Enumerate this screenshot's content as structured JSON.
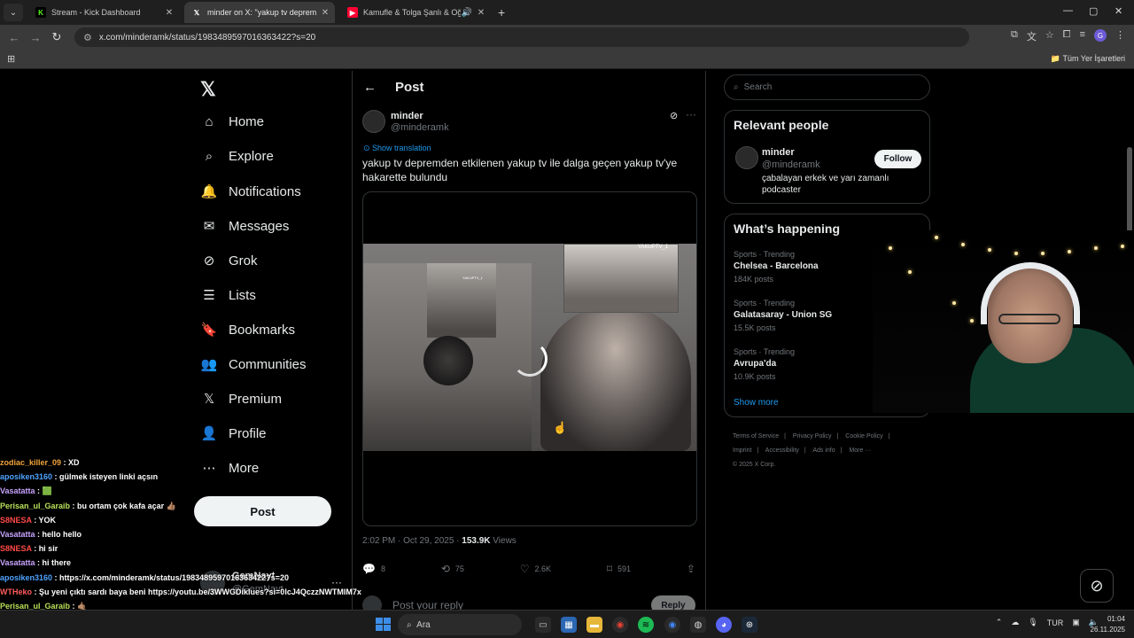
{
  "browser": {
    "tabs": [
      {
        "title": "Stream - Kick Dashboard",
        "favicon": "K",
        "color": "#53fc18",
        "active": false
      },
      {
        "title": "minder on X: \"yakup tv deprem",
        "favicon": "𝕏",
        "color": "#ffffff",
        "active": true
      },
      {
        "title": "Kamufle & Tolga Şanlı & Oğ",
        "favicon": "▶",
        "color": "#ff0033",
        "active": false
      }
    ],
    "url": "x.com/minderamk/status/1983489597016363422?s=20",
    "bookmarks_all": "Tüm Yer İşaretleri"
  },
  "nav": {
    "logo": "𝕏",
    "items": [
      {
        "label": "Home",
        "icon": "⌂"
      },
      {
        "label": "Explore",
        "icon": "⌕"
      },
      {
        "label": "Notifications",
        "icon": "🔔"
      },
      {
        "label": "Messages",
        "icon": "✉"
      },
      {
        "label": "Grok",
        "icon": "⊘"
      },
      {
        "label": "Lists",
        "icon": "☰"
      },
      {
        "label": "Bookmarks",
        "icon": "🔖"
      },
      {
        "label": "Communities",
        "icon": "👥"
      },
      {
        "label": "Premium",
        "icon": "𝕏"
      },
      {
        "label": "Profile",
        "icon": "👤"
      },
      {
        "label": "More",
        "icon": "⋯"
      }
    ],
    "post_button": "Post",
    "account": {
      "name": "GemNayt",
      "handle": "@GemNayt"
    }
  },
  "main": {
    "header_title": "Post",
    "author": {
      "name": "minder",
      "handle": "@minderamk"
    },
    "show_translation": "Show translation",
    "text": "yakup tv depremden etkilenen yakup tv ile dalga geçen yakup tv'ye hakarette bulundu",
    "video_tag_top": "YAKUPTV_1",
    "video_tag_small": "YAKUPTV_1",
    "meta_time": "2:02 PM · Oct 29, 2025 · ",
    "meta_views_count": "153.9K",
    "meta_views_label": " Views",
    "actions": {
      "replies": "8",
      "reposts": "75",
      "likes": "2.6K",
      "bookmarks": "591"
    },
    "reply_placeholder": "Post your reply",
    "reply_button": "Reply"
  },
  "sidebar": {
    "search_placeholder": "Search",
    "relevant_title": "Relevant people",
    "person": {
      "name": "minder",
      "handle": "@minderamk",
      "bio": "çabalayan erkek ve yarı zamanlı podcaster",
      "follow": "Follow"
    },
    "happening_title": "What’s happening",
    "trends": [
      {
        "meta": "Sports · Trending",
        "name": "Chelsea - Barcelona",
        "count": "184K posts"
      },
      {
        "meta": "Sports · Trending",
        "name": "Galatasaray - Union SG",
        "count": "15.5K posts"
      },
      {
        "meta": "Sports · Trending",
        "name": "Avrupa'da",
        "count": "10.9K posts"
      }
    ],
    "show_more": "Show more",
    "footer": [
      "Terms of Service",
      "|",
      "Privacy Policy",
      "|",
      "Cookie Policy",
      "|",
      "Imprint",
      "|",
      "Accessibility",
      "|",
      "Ads info",
      "|",
      "More ···",
      "© 2025 X Corp."
    ]
  },
  "chat": [
    {
      "user": "zodiac_killer_09",
      "color": "#f2a33a",
      "msg": "XD"
    },
    {
      "user": "aposiken3160",
      "color": "#4fa3ff",
      "msg": "gülmek isteyen linki açsın"
    },
    {
      "user": "Vasatatta",
      "color": "#c8a4ff",
      "msg": "🟩"
    },
    {
      "user": "Perisan_ul_Garaib",
      "color": "#b9e05a",
      "msg": "bu ortam çok kafa açar 👍🏽"
    },
    {
      "user": "S8NESA",
      "color": "#ff4a4a",
      "msg": "YOK"
    },
    {
      "user": "Vasatatta",
      "color": "#c8a4ff",
      "msg": "hello hello"
    },
    {
      "user": "S8NESA",
      "color": "#ff4a4a",
      "msg": "hi sir"
    },
    {
      "user": "Vasatatta",
      "color": "#c8a4ff",
      "msg": "hi there"
    },
    {
      "user": "aposiken3160",
      "color": "#4fa3ff",
      "msg": "https://x.com/minderamk/status/1983489597016363422?s=20"
    },
    {
      "user": "WTHeko",
      "color": "#ff5b5b",
      "msg": "Şu yeni çıktı sardı baya beni https://youtu.be/3WWGDiklues?si=0lcJ4QczzNWTMIM7x"
    },
    {
      "user": "Perisan_ul_Garaib",
      "color": "#b9e05a",
      "msg": "🤙🏽"
    }
  ],
  "taskbar": {
    "search": "Ara",
    "lang": "TUR",
    "time": "01:04",
    "date": "26.11.2025"
  }
}
